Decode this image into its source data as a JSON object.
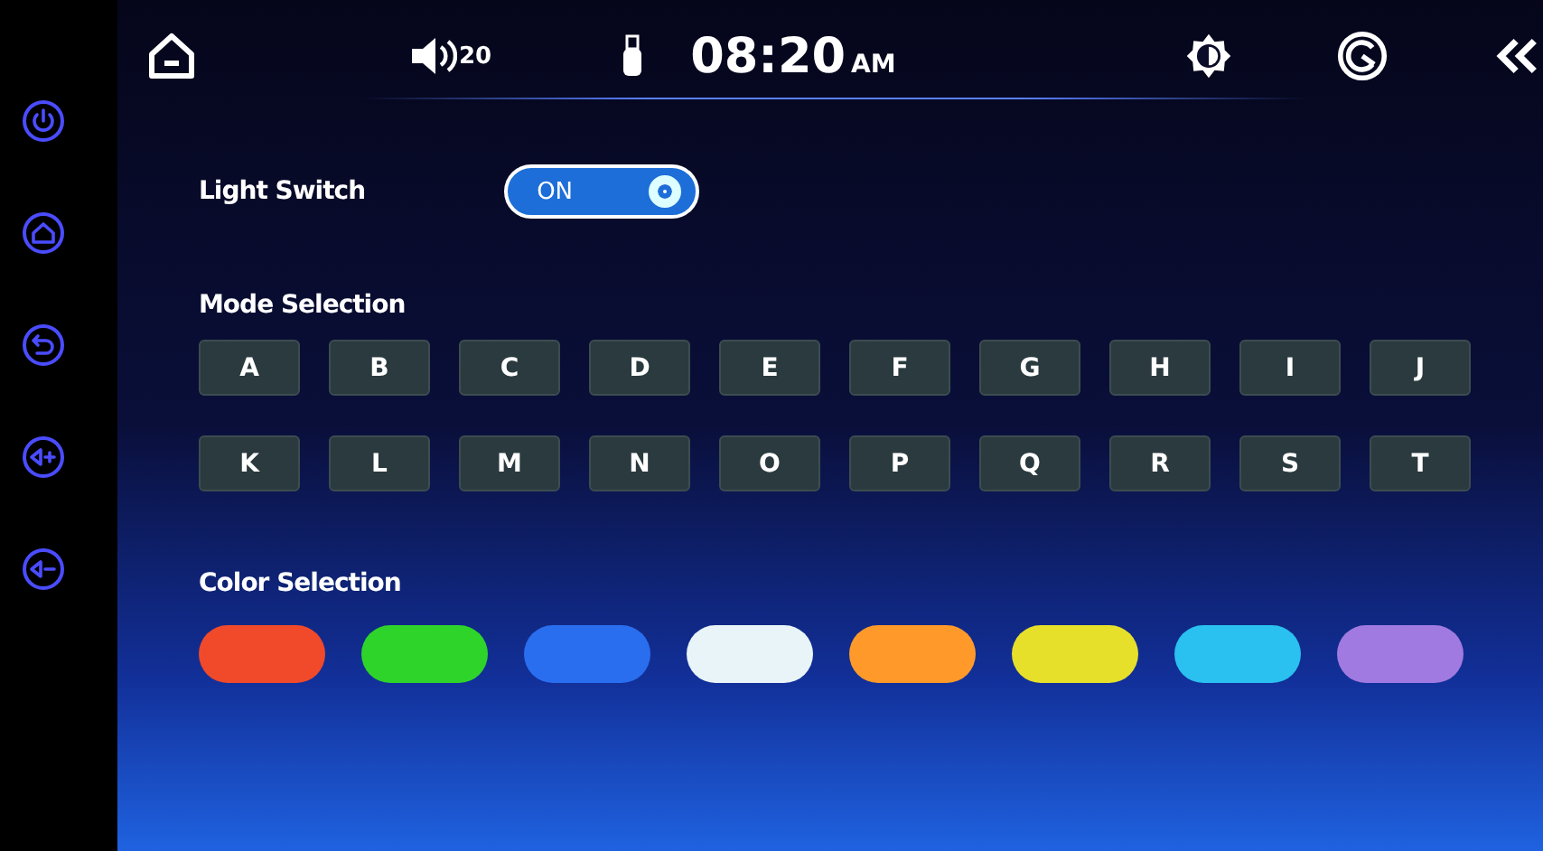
{
  "status_bar": {
    "volume": "20",
    "time": "08:20",
    "meridiem": "AM"
  },
  "light_switch": {
    "label": "Light Switch",
    "state_text": "ON",
    "on": true
  },
  "mode_selection": {
    "title": "Mode Selection",
    "modes": [
      "A",
      "B",
      "C",
      "D",
      "E",
      "F",
      "G",
      "H",
      "I",
      "J",
      "K",
      "L",
      "M",
      "N",
      "O",
      "P",
      "Q",
      "R",
      "S",
      "T"
    ]
  },
  "color_selection": {
    "title": "Color Selection",
    "colors": [
      {
        "color": "#f04a2a"
      },
      {
        "color": "#2fd42a"
      },
      {
        "color": "#2a6ef0"
      },
      {
        "color": "#e8f4f8"
      },
      {
        "color": "#ff9a2a"
      },
      {
        "color": "#e6e02a"
      },
      {
        "color": "#2ac0f0"
      },
      {
        "color": "#a07ae0"
      }
    ]
  }
}
